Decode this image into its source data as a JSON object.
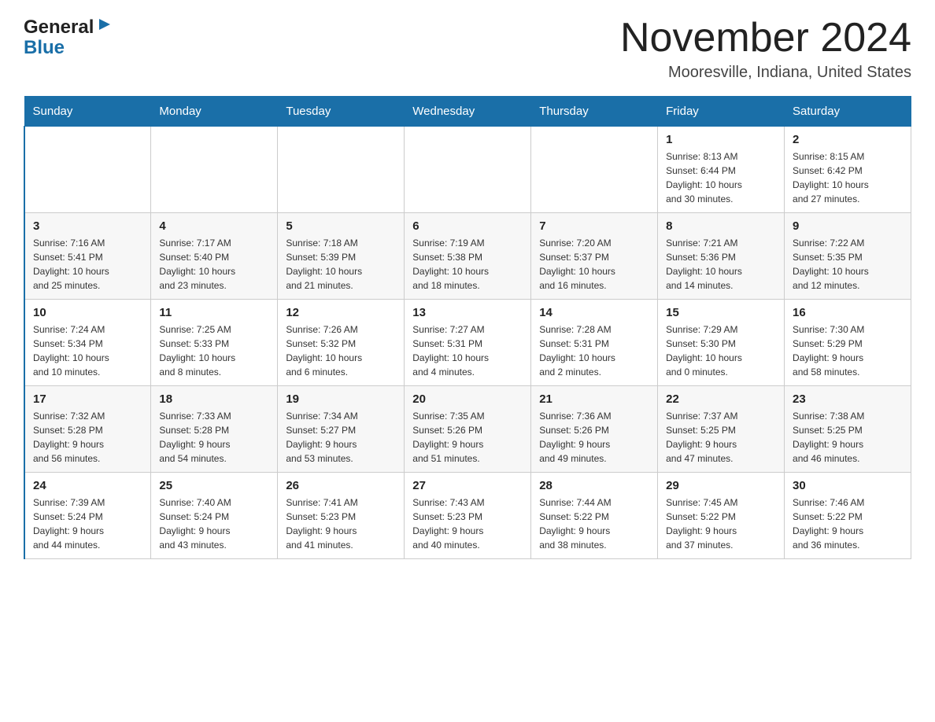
{
  "header": {
    "logo_line1": "General",
    "logo_line2": "Blue",
    "month_title": "November 2024",
    "location": "Mooresville, Indiana, United States"
  },
  "weekdays": [
    "Sunday",
    "Monday",
    "Tuesday",
    "Wednesday",
    "Thursday",
    "Friday",
    "Saturday"
  ],
  "weeks": [
    [
      {
        "day": "",
        "info": ""
      },
      {
        "day": "",
        "info": ""
      },
      {
        "day": "",
        "info": ""
      },
      {
        "day": "",
        "info": ""
      },
      {
        "day": "",
        "info": ""
      },
      {
        "day": "1",
        "info": "Sunrise: 8:13 AM\nSunset: 6:44 PM\nDaylight: 10 hours\nand 30 minutes."
      },
      {
        "day": "2",
        "info": "Sunrise: 8:15 AM\nSunset: 6:42 PM\nDaylight: 10 hours\nand 27 minutes."
      }
    ],
    [
      {
        "day": "3",
        "info": "Sunrise: 7:16 AM\nSunset: 5:41 PM\nDaylight: 10 hours\nand 25 minutes."
      },
      {
        "day": "4",
        "info": "Sunrise: 7:17 AM\nSunset: 5:40 PM\nDaylight: 10 hours\nand 23 minutes."
      },
      {
        "day": "5",
        "info": "Sunrise: 7:18 AM\nSunset: 5:39 PM\nDaylight: 10 hours\nand 21 minutes."
      },
      {
        "day": "6",
        "info": "Sunrise: 7:19 AM\nSunset: 5:38 PM\nDaylight: 10 hours\nand 18 minutes."
      },
      {
        "day": "7",
        "info": "Sunrise: 7:20 AM\nSunset: 5:37 PM\nDaylight: 10 hours\nand 16 minutes."
      },
      {
        "day": "8",
        "info": "Sunrise: 7:21 AM\nSunset: 5:36 PM\nDaylight: 10 hours\nand 14 minutes."
      },
      {
        "day": "9",
        "info": "Sunrise: 7:22 AM\nSunset: 5:35 PM\nDaylight: 10 hours\nand 12 minutes."
      }
    ],
    [
      {
        "day": "10",
        "info": "Sunrise: 7:24 AM\nSunset: 5:34 PM\nDaylight: 10 hours\nand 10 minutes."
      },
      {
        "day": "11",
        "info": "Sunrise: 7:25 AM\nSunset: 5:33 PM\nDaylight: 10 hours\nand 8 minutes."
      },
      {
        "day": "12",
        "info": "Sunrise: 7:26 AM\nSunset: 5:32 PM\nDaylight: 10 hours\nand 6 minutes."
      },
      {
        "day": "13",
        "info": "Sunrise: 7:27 AM\nSunset: 5:31 PM\nDaylight: 10 hours\nand 4 minutes."
      },
      {
        "day": "14",
        "info": "Sunrise: 7:28 AM\nSunset: 5:31 PM\nDaylight: 10 hours\nand 2 minutes."
      },
      {
        "day": "15",
        "info": "Sunrise: 7:29 AM\nSunset: 5:30 PM\nDaylight: 10 hours\nand 0 minutes."
      },
      {
        "day": "16",
        "info": "Sunrise: 7:30 AM\nSunset: 5:29 PM\nDaylight: 9 hours\nand 58 minutes."
      }
    ],
    [
      {
        "day": "17",
        "info": "Sunrise: 7:32 AM\nSunset: 5:28 PM\nDaylight: 9 hours\nand 56 minutes."
      },
      {
        "day": "18",
        "info": "Sunrise: 7:33 AM\nSunset: 5:28 PM\nDaylight: 9 hours\nand 54 minutes."
      },
      {
        "day": "19",
        "info": "Sunrise: 7:34 AM\nSunset: 5:27 PM\nDaylight: 9 hours\nand 53 minutes."
      },
      {
        "day": "20",
        "info": "Sunrise: 7:35 AM\nSunset: 5:26 PM\nDaylight: 9 hours\nand 51 minutes."
      },
      {
        "day": "21",
        "info": "Sunrise: 7:36 AM\nSunset: 5:26 PM\nDaylight: 9 hours\nand 49 minutes."
      },
      {
        "day": "22",
        "info": "Sunrise: 7:37 AM\nSunset: 5:25 PM\nDaylight: 9 hours\nand 47 minutes."
      },
      {
        "day": "23",
        "info": "Sunrise: 7:38 AM\nSunset: 5:25 PM\nDaylight: 9 hours\nand 46 minutes."
      }
    ],
    [
      {
        "day": "24",
        "info": "Sunrise: 7:39 AM\nSunset: 5:24 PM\nDaylight: 9 hours\nand 44 minutes."
      },
      {
        "day": "25",
        "info": "Sunrise: 7:40 AM\nSunset: 5:24 PM\nDaylight: 9 hours\nand 43 minutes."
      },
      {
        "day": "26",
        "info": "Sunrise: 7:41 AM\nSunset: 5:23 PM\nDaylight: 9 hours\nand 41 minutes."
      },
      {
        "day": "27",
        "info": "Sunrise: 7:43 AM\nSunset: 5:23 PM\nDaylight: 9 hours\nand 40 minutes."
      },
      {
        "day": "28",
        "info": "Sunrise: 7:44 AM\nSunset: 5:22 PM\nDaylight: 9 hours\nand 38 minutes."
      },
      {
        "day": "29",
        "info": "Sunrise: 7:45 AM\nSunset: 5:22 PM\nDaylight: 9 hours\nand 37 minutes."
      },
      {
        "day": "30",
        "info": "Sunrise: 7:46 AM\nSunset: 5:22 PM\nDaylight: 9 hours\nand 36 minutes."
      }
    ]
  ]
}
